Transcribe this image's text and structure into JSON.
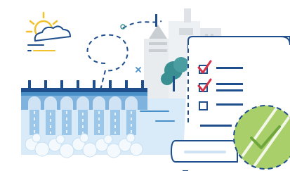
{
  "illustration": {
    "palette": {
      "outline": "#1f4e8c",
      "sky_blue": "#cfe3f4",
      "water_blue": "#d9ebf8",
      "mid_blue": "#4a90c8",
      "light_gray": "#e9ecef",
      "mid_gray": "#c9ced3",
      "sun_yellow": "#f2c12e",
      "check_red": "#d5344b",
      "tree_teal": "#3a8f93",
      "badge_green": "#a9cf6a",
      "badge_green_dark": "#6fa63b",
      "foam_white": "#ffffff"
    },
    "icons": [
      "sun-icon",
      "cloud-icon",
      "dam-icon",
      "tree-icon",
      "city-tower-icon",
      "checklist-document-icon",
      "checkbox-checked-icon",
      "checkbox-empty-icon",
      "check-badge-icon"
    ],
    "checklist": {
      "items": [
        {
          "checked": true
        },
        {
          "checked": true
        },
        {
          "checked": false
        }
      ]
    }
  }
}
